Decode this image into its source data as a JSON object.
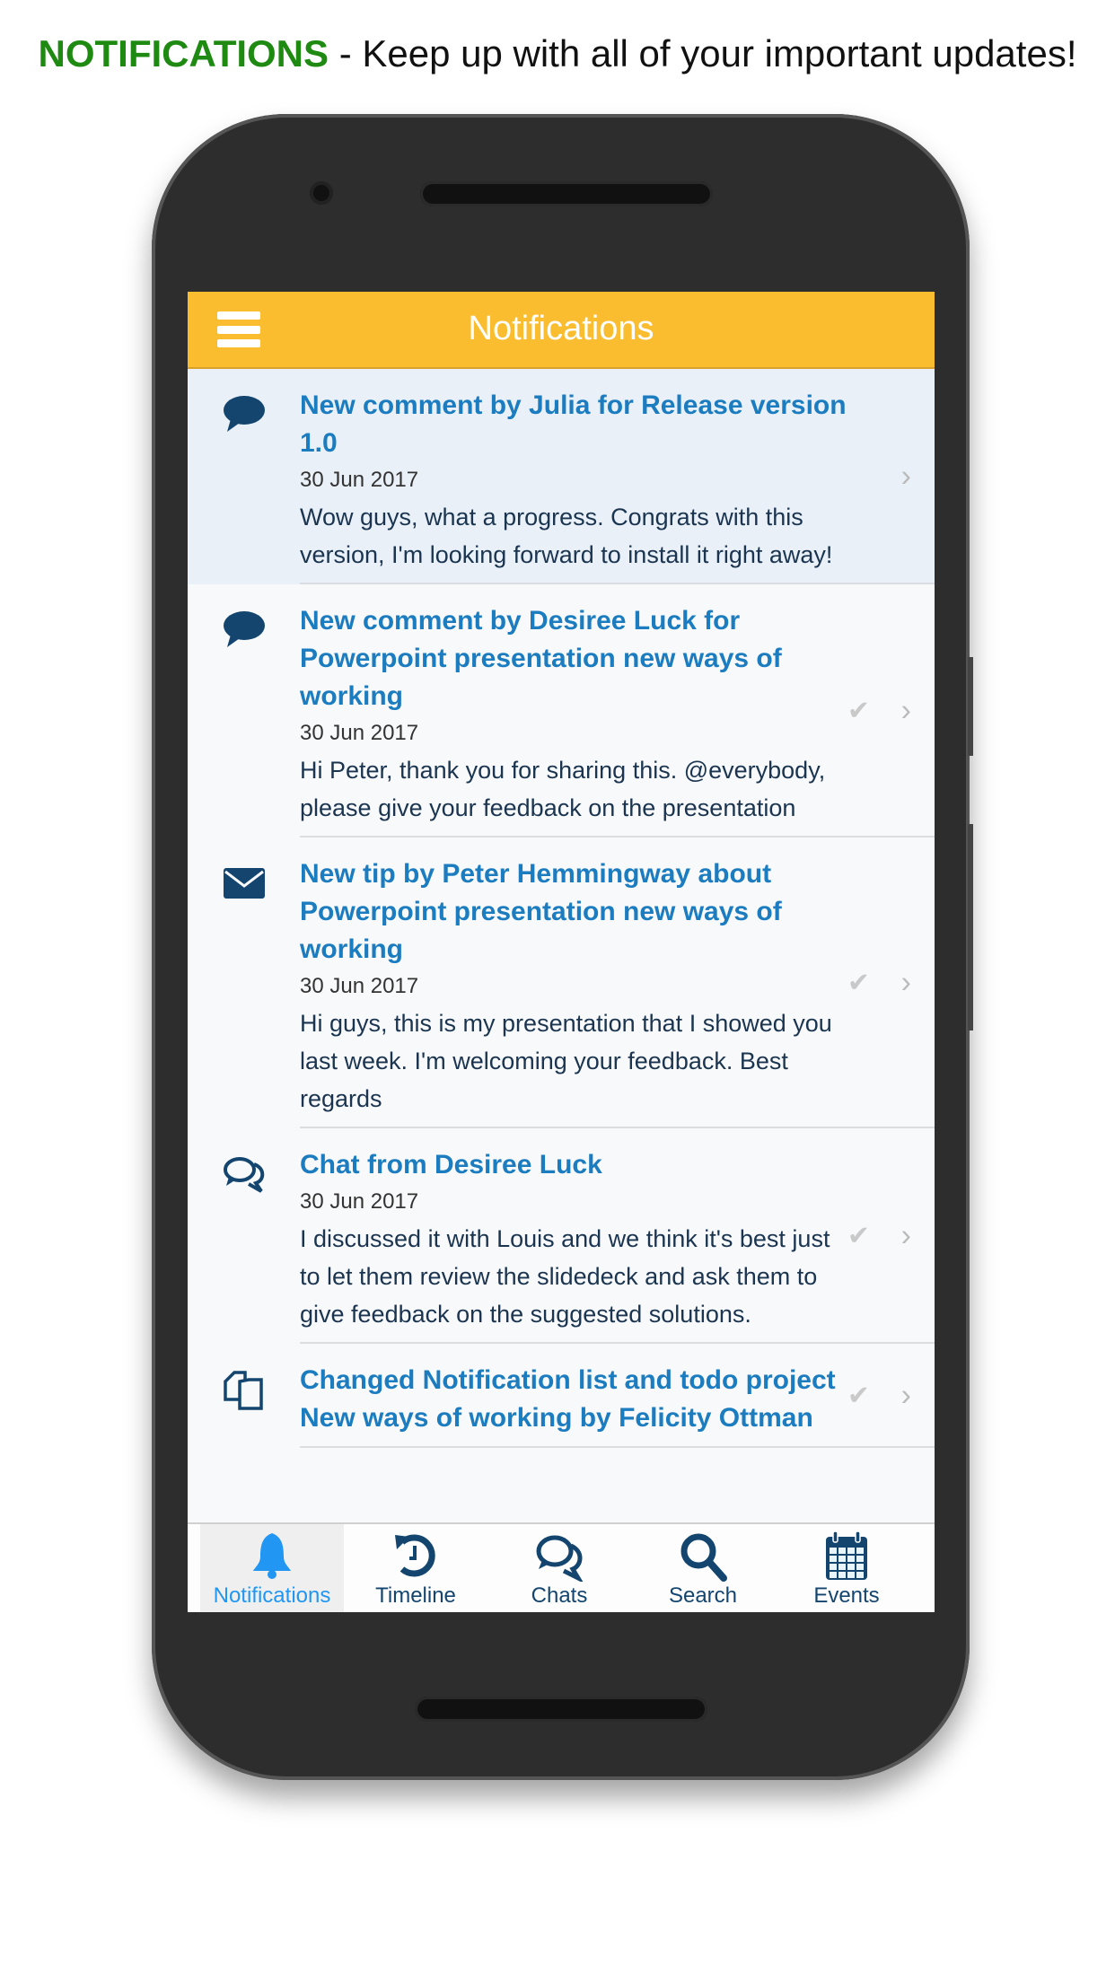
{
  "caption": {
    "highlight": "NOTIFICATIONS",
    "rest": " - Keep up with all of your important updates!"
  },
  "header": {
    "title": "Notifications",
    "menu_icon": "hamburger-icon"
  },
  "notifications": [
    {
      "icon": "comment-icon",
      "title": "New comment by Julia for Release version 1.0",
      "date": "30 Jun 2017",
      "body": "Wow guys, what a progress. Congrats with this version, I'm looking forward to install it right away!",
      "unread": true
    },
    {
      "icon": "comment-icon",
      "title": "New comment by Desiree Luck for Powerpoint presentation new ways of working",
      "date": "30 Jun 2017",
      "body": "Hi Peter, thank you for sharing this. @everybody, please give your feedback on the presentation"
    },
    {
      "icon": "envelope-icon",
      "title": "New tip by Peter Hemmingway about Powerpoint presentation new ways of working",
      "date": "30 Jun 2017",
      "body": "Hi guys, this is my presentation that I showed you last week. I'm welcoming your feedback. Best regards"
    },
    {
      "icon": "chats-icon",
      "title": "Chat from Desiree Luck",
      "date": "30 Jun 2017",
      "body": "I discussed it with Louis and we think it's best just to let them review the slidedeck and ask them to give feedback on the suggested solutions."
    },
    {
      "icon": "copy-icon",
      "title": "Changed Notification list and todo project New ways of working by Felicity Ottman",
      "date": "",
      "body": ""
    }
  ],
  "nav": [
    {
      "label": "Notifications",
      "icon": "bell-icon",
      "active": true
    },
    {
      "label": "Timeline",
      "icon": "history-icon"
    },
    {
      "label": "Chats",
      "icon": "chats-icon"
    },
    {
      "label": "Search",
      "icon": "search-icon"
    },
    {
      "label": "Events",
      "icon": "calendar-icon"
    }
  ],
  "colors": {
    "header": "#fbbd30",
    "accent": "#1c7cc0",
    "active_tab": "#2196f3",
    "caption_highlight": "#1e8a12",
    "icon": "#13456f"
  }
}
